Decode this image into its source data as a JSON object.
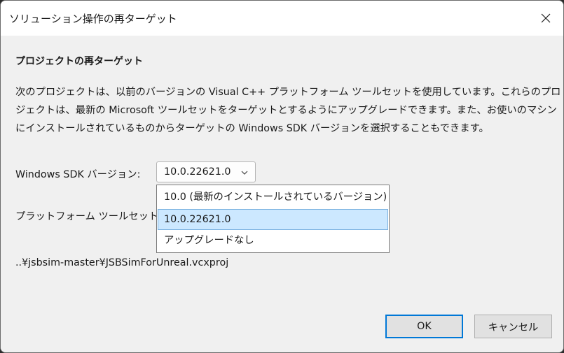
{
  "window": {
    "title": "ソリューション操作の再ターゲット",
    "close_icon": "close-icon"
  },
  "content": {
    "heading": "プロジェクトの再ターゲット",
    "description_lines": [
      "次のプロジェクトは、以前のバージョンの Visual C++ プラットフォーム ツールセットを使用しています。これらのプロ",
      "ジェクトは、最新の Microsoft ツールセットをターゲットとするようにアップグレードできます。また、お使いのマシン",
      "にインストールされているものからターゲットの Windows SDK バージョンを選択することもできます。"
    ],
    "sdk_label": "Windows SDK バージョン:",
    "sdk_selected": "10.0.22621.0",
    "sdk_options": [
      "10.0 (最新のインストールされているバージョン)",
      "10.0.22621.0",
      "アップグレードなし"
    ],
    "sdk_highlighted_index": 1,
    "toolset_label": "プラットフォーム ツールセット:",
    "project_path": "..¥jsbsim-master¥JSBSimForUnreal.vcxproj"
  },
  "buttons": {
    "ok": "OK",
    "cancel": "キャンセル"
  },
  "colors": {
    "accent": "#0078d7",
    "highlight": "#cce8ff"
  }
}
